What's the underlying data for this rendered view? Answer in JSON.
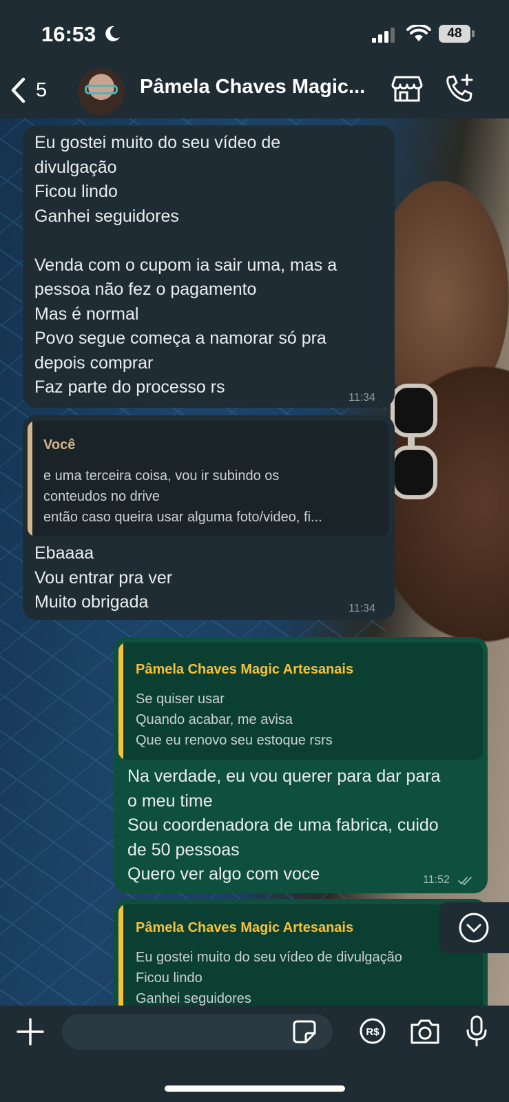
{
  "status": {
    "time": "16:53",
    "battery": "48"
  },
  "header": {
    "back_count": "5",
    "title": "Pâmela Chaves Magic..."
  },
  "messages": [
    {
      "direction": "in",
      "text": "Eu gostei muito do seu vídeo de\ndivulgação\nFicou lindo\nGanhei seguidores\n\nVenda com o cupom ia sair uma, mas a\npessoa não fez o pagamento\nMas é normal\nPovo segue começa a namorar só pra\ndepois comprar\nFaz parte do processo rs",
      "time": "11:34"
    },
    {
      "direction": "in",
      "quote": {
        "author": "Você",
        "text": "e uma terceira coisa, vou ir subindo os\nconteudos no drive\nentão caso queira usar alguma foto/video, fi..."
      },
      "text": "Ebaaaa\nVou entrar pra ver\nMuito obrigada",
      "time": "11:34"
    },
    {
      "direction": "out",
      "quote": {
        "author": "Pâmela Chaves Magic Artesanais",
        "text": "Se quiser usar\nQuando acabar, me avisa\nQue eu renovo seu estoque rsrs"
      },
      "text": "Na verdade, eu vou querer para dar para\no meu time\nSou coordenadora de uma fabrica, cuido\nde 50 pessoas\nQuero ver algo com voce",
      "time": "11:52"
    },
    {
      "direction": "out",
      "quote": {
        "author": "Pâmela Chaves Magic Artesanais",
        "text": "Eu gostei muito do seu vídeo de divulgação\nFicou lindo\nGanhei seguidores"
      }
    }
  ],
  "composer": {
    "placeholder": ""
  },
  "colors": {
    "incoming_bubble": "#202c33",
    "outgoing_bubble": "#0f4f3d",
    "quote_you": "#d3b68c",
    "quote_contact": "#f7c23b",
    "bar": "#1f2c33"
  },
  "icons": [
    "moon-icon",
    "signal-icon",
    "wifi-icon",
    "battery-icon",
    "back-chevron-icon",
    "store-icon",
    "add-call-icon",
    "scroll-down-icon",
    "plus-icon",
    "sticker-icon",
    "pix-payment-icon",
    "camera-icon",
    "microphone-icon",
    "double-check-icon"
  ]
}
